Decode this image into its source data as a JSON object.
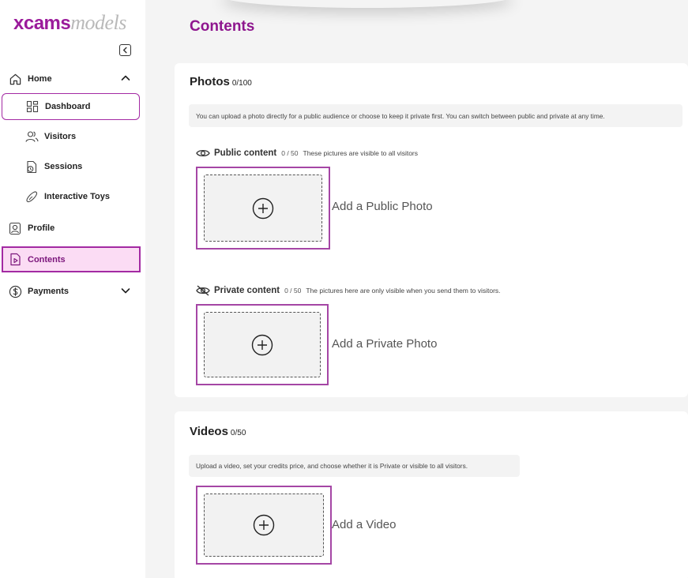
{
  "logo": {
    "part1": "xcams",
    "part2": "models"
  },
  "sidebar": {
    "home": "Home",
    "dashboard": "Dashboard",
    "visitors": "Visitors",
    "sessions": "Sessions",
    "interactive_toys": "Interactive Toys",
    "profile": "Profile",
    "contents": "Contents",
    "payments": "Payments"
  },
  "page": {
    "title": "Contents"
  },
  "photos": {
    "title": "Photos",
    "count": "0/100",
    "info": "You can upload a photo directly for a public audience or choose to keep it private first. You can switch between public and private at any time.",
    "public": {
      "title": "Public content",
      "count": "0 / 50",
      "desc": "These pictures are visible to all visitors",
      "add_label": "Add a Public Photo"
    },
    "private": {
      "title": "Private content",
      "count": "0 / 50",
      "desc": "The pictures here are only visible when you send them to visitors.",
      "add_label": "Add a Private Photo"
    }
  },
  "videos": {
    "title": "Videos",
    "count": "0/50",
    "info": "Upload a video, set your credits price, and choose whether it is Private or visible to all visitors.",
    "add_label": "Add a Video"
  },
  "colors": {
    "brand": "#9b1b9b",
    "active_bg": "#fbdcf4",
    "highlight_border": "#a546a5"
  }
}
